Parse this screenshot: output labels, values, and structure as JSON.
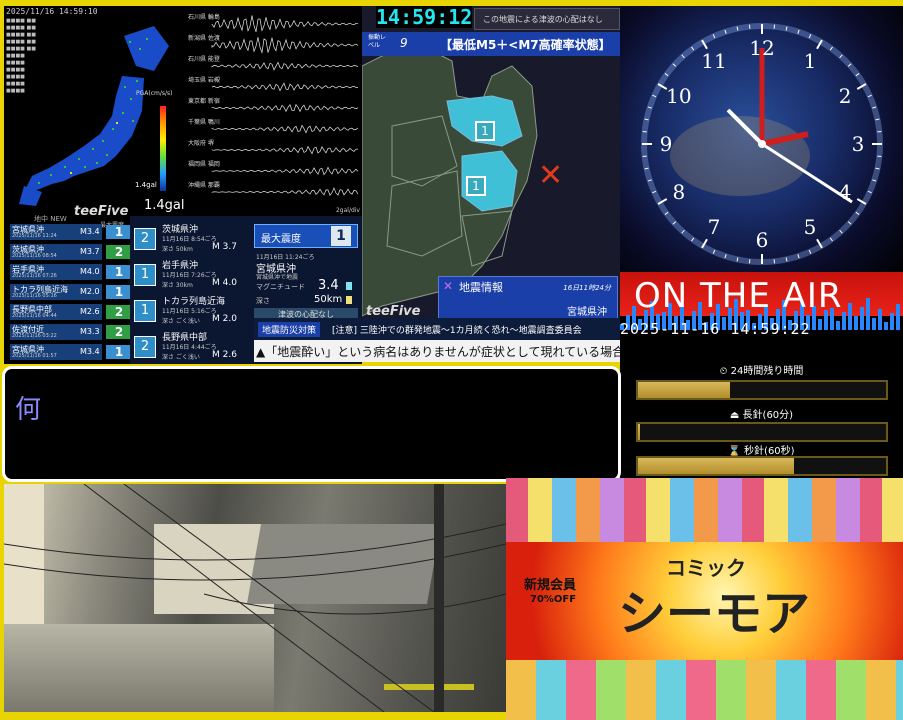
{
  "kmoni": {
    "timestamp": "2025/11/16 14:59:10",
    "pga_label": "PGA(cm/s/s)",
    "pga_value": "1.4gal",
    "brand": "teeFive",
    "new_label": "地中 NEW",
    "intensity_header": "最大震度",
    "quakes": [
      {
        "place": "宮城県沖",
        "time": "2025/11/16 11:24",
        "mag": "M3.4",
        "int": "1",
        "color": "#3a8fd0"
      },
      {
        "place": "茨城県沖",
        "time": "2025/11/16 08:54",
        "mag": "M3.7",
        "int": "2",
        "color": "#2f9e44"
      },
      {
        "place": "岩手県沖",
        "time": "2025/11/16 07:26",
        "mag": "M4.0",
        "int": "1",
        "color": "#3a8fd0"
      },
      {
        "place": "トカラ列島近海",
        "time": "2025/11/16 05:16",
        "mag": "M2.0",
        "int": "1",
        "color": "#3a8fd0"
      },
      {
        "place": "長野県中部",
        "time": "2025/11/16 04:44",
        "mag": "M2.6",
        "int": "2",
        "color": "#2f9e44"
      },
      {
        "place": "佐渡付近",
        "time": "2025/11/16 03:22",
        "mag": "M3.3",
        "int": "2",
        "color": "#2f9e44"
      },
      {
        "place": "宮城県沖",
        "time": "2025/11/16 01:57",
        "mag": "M3.4",
        "int": "1",
        "color": "#3a8fd0"
      }
    ]
  },
  "waves": {
    "stations": [
      "石川県 輪島",
      "新潟県 佐渡",
      "石川県 能登",
      "埼玉県 岩槻",
      "東京都 新宿",
      "千葉県 鴨川",
      "大阪府 堺",
      "福岡県 福岡",
      "沖縄県 那覇"
    ],
    "scale_label": "2gal/div"
  },
  "list2": {
    "max_int_label": "最大震度",
    "max_int_value": "1",
    "entries": [
      {
        "int": "2",
        "place": "茨城県沖",
        "time": "11月16日 8:54ごろ",
        "depth": "深さ 50km",
        "mag": "M 3.7"
      },
      {
        "int": "1",
        "place": "岩手県沖",
        "time": "11月16日 7:26ごろ",
        "depth": "深さ 30km",
        "mag": "M 4.0"
      },
      {
        "int": "1",
        "place": "トカラ列島近海",
        "time": "11月16日 5:16ごろ",
        "depth": "深さ ごく浅い",
        "mag": "M 2.0"
      },
      {
        "int": "2",
        "place": "長野県中部",
        "time": "11月16日 4:44ごろ",
        "depth": "深さ ごく浅い",
        "mag": "M 2.6"
      }
    ],
    "latest_time": "11月16日 11:24ごろ",
    "latest_place": "宮城県沖",
    "latest_sub": "宮城県沖で地震",
    "mag_label": "マグニチュード",
    "mag_value": "3.4",
    "depth_label": "深さ",
    "depth_value": "50km",
    "tsunami": "津波の心配なし"
  },
  "map": {
    "clock": "14:59:12",
    "tsunami_note": "この地震による津波の心配はなし",
    "level_label": "振動レベル",
    "level_value": "9",
    "banner": "【最低M5＋<M7高確率状態】",
    "region_int": [
      "1",
      "1"
    ],
    "info_title": "地震情報",
    "info_time": "16日11時24分",
    "info_place": "宮城県沖",
    "brand": "teeFive"
  },
  "ticker": {
    "tag": "地震防災対策",
    "headline": "[注意] 三陸沖での群発地震～1カ月続く恐れ～地震調査委員会",
    "scroll": "▲「地震酔い」という病名はありませんが症状として現れている場合"
  },
  "clock": {
    "numbers": [
      "12",
      "1",
      "2",
      "3",
      "4",
      "5",
      "6",
      "7",
      "8",
      "9",
      "10",
      "11"
    ]
  },
  "onair": {
    "text": "ON THE AIR",
    "datetime": "2025-11-16 14:59:22"
  },
  "remain": {
    "bars": [
      {
        "icon": "⏲",
        "label": "24時間残り時間",
        "value": 0.37
      },
      {
        "icon": "⏏",
        "label": "長針(60分)",
        "value": 0.01
      },
      {
        "icon": "⌛",
        "label": "秒針(60秒)",
        "value": 0.63
      }
    ]
  },
  "subtitle": {
    "text": "何"
  },
  "ad": {
    "tag1": "新規会員",
    "tag2": "70%OFF",
    "small": "コミック",
    "brand": "シーモア"
  },
  "colors": {
    "border": "#e8d400",
    "blue_region": "#3fc0d6",
    "banner_bg": "#1b3fa8",
    "onair_red": "#d9140f"
  }
}
